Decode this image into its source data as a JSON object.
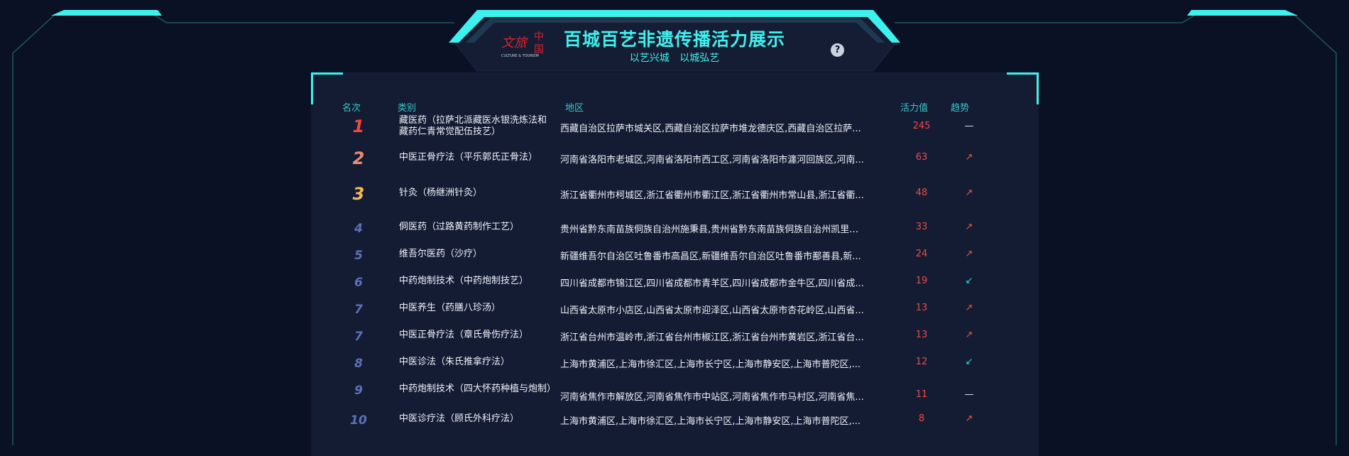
{
  "header": {
    "title": "百城百艺非遗传播活力展示",
    "subtitle": "以艺兴城 以城弘艺",
    "logo_text": "文旅中国",
    "logo_en": "CULTURE & TOURISM",
    "help": "?"
  },
  "table": {
    "columns": {
      "rank": "名次",
      "category": "类别",
      "region": "地区",
      "score": "活力值",
      "trend": "趋势"
    },
    "rows": [
      {
        "rank": "1",
        "category": "藏医药（拉萨北派藏医水银洗炼法和藏药仁青常觉配伍技艺）",
        "region": "西藏自治区拉萨市城关区,西藏自治区拉萨市堆龙德庆区,西藏自治区拉萨...",
        "score": "245",
        "trend": "flat"
      },
      {
        "rank": "2",
        "category": "中医正骨疗法（平乐郭氏正骨法）",
        "region": "河南省洛阳市老城区,河南省洛阳市西工区,河南省洛阳市瀍河回族区,河南...",
        "score": "63",
        "trend": "up"
      },
      {
        "rank": "3",
        "category": "针灸（杨继洲针灸）",
        "region": "浙江省衢州市柯城区,浙江省衢州市衢江区,浙江省衢州市常山县,浙江省衢...",
        "score": "48",
        "trend": "up"
      },
      {
        "rank": "4",
        "category": "侗医药（过路黄药制作工艺）",
        "region": "贵州省黔东南苗族侗族自治州施秉县,贵州省黔东南苗族侗族自治州凯里市...",
        "score": "33",
        "trend": "up"
      },
      {
        "rank": "5",
        "category": "维吾尔医药（沙疗）",
        "region": "新疆维吾尔自治区吐鲁番市高昌区,新疆维吾尔自治区吐鲁番市鄯善县,新...",
        "score": "24",
        "trend": "up"
      },
      {
        "rank": "6",
        "category": "中药炮制技术（中药炮制技艺）",
        "region": "四川省成都市锦江区,四川省成都市青羊区,四川省成都市金牛区,四川省成...",
        "score": "19",
        "trend": "down"
      },
      {
        "rank": "7",
        "category": "中医养生（药膳八珍汤）",
        "region": "山西省太原市小店区,山西省太原市迎泽区,山西省太原市杏花岭区,山西省...",
        "score": "13",
        "trend": "up"
      },
      {
        "rank": "7",
        "category": "中医正骨疗法（章氏骨伤疗法）",
        "region": "浙江省台州市温岭市,浙江省台州市椒江区,浙江省台州市黄岩区,浙江省台...",
        "score": "13",
        "trend": "up"
      },
      {
        "rank": "8",
        "category": "中医诊法（朱氏推拿疗法）",
        "region": "上海市黄浦区,上海市徐汇区,上海市长宁区,上海市静安区,上海市普陀区,...",
        "score": "12",
        "trend": "down"
      },
      {
        "rank": "9",
        "category": "中药炮制技术（四大怀药种植与炮制）",
        "region": "河南省焦作市解放区,河南省焦作市中站区,河南省焦作市马村区,河南省焦...",
        "score": "11",
        "trend": "flat"
      },
      {
        "rank": "10",
        "category": "中医诊疗法（顾氏外科疗法）",
        "region": "上海市黄浦区,上海市徐汇区,上海市长宁区,上海市静安区,上海市普陀区,...",
        "score": "8",
        "trend": "up"
      }
    ]
  },
  "trend_symbols": {
    "up": "↗",
    "down": "↙",
    "flat": "—"
  },
  "colors": {
    "accent": "#3df1ee",
    "background": "#0b1124",
    "panel": "#141c34",
    "score": "#ef4a40"
  }
}
